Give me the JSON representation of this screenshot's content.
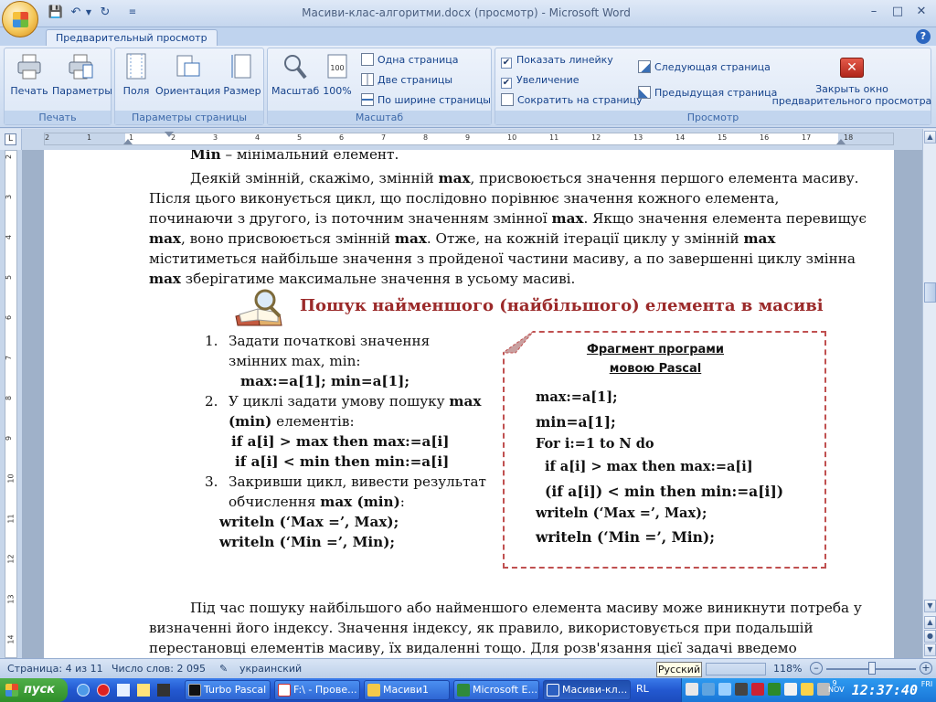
{
  "window": {
    "title": "Масиви-клас-алгоритми.docx (просмотр) - Microsoft Word",
    "minimize": "–",
    "maximize": "□",
    "close": "✕"
  },
  "ribbon": {
    "tab": "Предварительный просмотр",
    "help": "?",
    "groups": {
      "print": {
        "label": "Печать",
        "print_btn": "Печать",
        "params_btn": "Параметры"
      },
      "page_setup": {
        "label": "Параметры страницы",
        "margins_btn": "Поля",
        "orientation_btn": "Ориентация",
        "size_btn": "Размер"
      },
      "zoom": {
        "label": "Масштаб",
        "zoom_btn": "Масштаб",
        "zoom100_btn": "100%",
        "one_page": "Одна страница",
        "two_pages": "Две страницы",
        "page_width": "По ширине страницы"
      },
      "preview": {
        "label": "Просмотр",
        "show_ruler": "Показать линейку",
        "magnifier": "Увеличение",
        "shrink": "Сократить на страницу",
        "next_page": "Следующая страница",
        "prev_page": "Предыдущая страница",
        "close_preview": "Закрыть окно предварительного просмотра"
      }
    }
  },
  "ruler": {
    "h_labels": [
      "2",
      "1",
      "1",
      "2",
      "3",
      "4",
      "5",
      "6",
      "7",
      "8",
      "9",
      "10",
      "11",
      "12",
      "13",
      "14",
      "15",
      "16",
      "17",
      "18"
    ],
    "v_labels": [
      "2",
      "3",
      "4",
      "5",
      "6",
      "7",
      "8",
      "9",
      "10",
      "11",
      "12",
      "13",
      "14"
    ]
  },
  "document": {
    "line0_min": "Min",
    "line0_rest": " – мінімальний елемент.",
    "p1": [
      "Деякій змінній, скажімо, змінній ",
      "max",
      ", присвоюється значення першого елемента масиву."
    ],
    "p1_l2": "Після цього виконується цикл, що послідовно порівнює значення кожного елемента,",
    "p1_l3a": "починаючи з другого, із поточним значенням змінної ",
    "p1_l3b": "max",
    "p1_l3c": ". Якщо значення елемента перевищує",
    "p1_l4a": "max",
    "p1_l4b": ", воно присвоюється змінній ",
    "p1_l4c": "max",
    "p1_l4d": ". Отже, на кожній ітерації циклу у змінній ",
    "p1_l4e": "max",
    "p1_l5": "міститиметься найбільше значення з пройденої частини масиву, а по завершенні циклу змінна",
    "p1_l6a": "max",
    "p1_l6b": " зберігатиме максимальне значення в усьому масиві.",
    "heading": "Пошук найменшого (найбільшого) елемента в масиві",
    "list": {
      "n1": "1.",
      "i1_l1": "Задати початкові значення",
      "i1_l2": "змінних max, min:",
      "i1_l3": "max:=a[1]; min=a[1];",
      "n2": "2.",
      "i2_l1a": "У циклі задати умову пошуку ",
      "i2_l1b": "max",
      "i2_l2a": "(min)",
      "i2_l2b": " елементів:",
      "i2_l3": "if a[i] > max then max:=a[i]",
      "i2_l4": "if a[i] < min then min:=a[i]",
      "n3": "3.",
      "i3_l1": "Закривши цикл, вивести результат",
      "i3_l2a": "обчислення ",
      "i3_l2b": "max (min)",
      "i3_l2c": ":",
      "w1": "writeln (‘Max =’, Max);",
      "w2": "writeln (‘Min =’, Min);"
    },
    "codebox": {
      "title1": "Фрагмент програми",
      "title2": "мовою Pascal",
      "lines": [
        "max:=a[1];",
        "min=a[1];",
        "For i:=1 to N do",
        "if a[i] > max then max:=a[i]",
        "(if a[i]) < min then min:=a[i])",
        "writeln (‘Max =’, Max);",
        "writeln (‘Min =’, Min);"
      ]
    },
    "p2_l1": "Під час пошуку найбільшого або найменшого елемента масиву може виникнути потреба у",
    "p2_l2": "визначенні його індексу.  Значення індексу, як правило, використовується при подальшій",
    "p2_l3": "перестановці елементів масиву, їх видаленні тощо. Для розв'язання цієї задачі введемо"
  },
  "statusbar": {
    "page": "Страница: 4 из 11",
    "words": "Число слов: 2 095",
    "language": "украинский",
    "lang_popup": "Русский",
    "zoom": "118%"
  },
  "taskbar": {
    "start": "пуск",
    "items": [
      "Turbo Pascal",
      "F:\\ - Прове...",
      "Масиви1",
      "Microsoft E...",
      "Масиви-кл..."
    ],
    "tray_label": "RL",
    "clock": "12:37:40",
    "date_line1": "9",
    "date_line2": "NOV",
    "date_line3": "FRI"
  },
  "colors": {
    "accent": "#15428b",
    "heading_red": "#9b2a2a",
    "codebox_border": "#c05050"
  }
}
